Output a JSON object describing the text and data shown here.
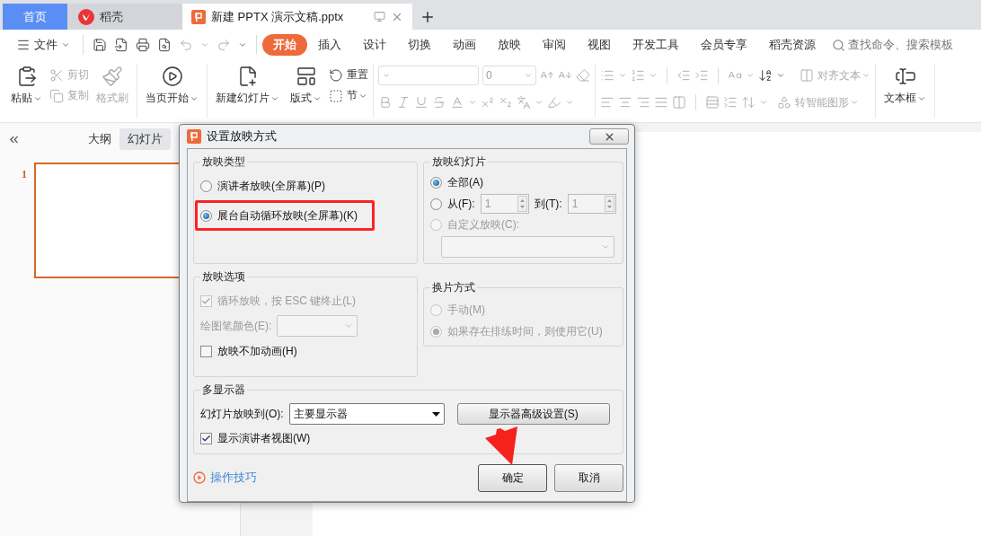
{
  "tabs": [
    {
      "label": "首页",
      "kind": "home",
      "selected": false
    },
    {
      "label": "稻壳",
      "kind": "app",
      "selected": false
    },
    {
      "label": "新建 PPTX 演示文稿.pptx",
      "kind": "document",
      "selected": true
    }
  ],
  "menu": {
    "file_label": "文件",
    "tabs": [
      {
        "label": "开始",
        "selected": true
      },
      {
        "label": "插入",
        "selected": false
      },
      {
        "label": "设计",
        "selected": false
      },
      {
        "label": "切换",
        "selected": false
      },
      {
        "label": "动画",
        "selected": false
      },
      {
        "label": "放映",
        "selected": false
      },
      {
        "label": "审阅",
        "selected": false
      },
      {
        "label": "视图",
        "selected": false
      },
      {
        "label": "开发工具",
        "selected": false
      },
      {
        "label": "会员专享",
        "selected": false
      },
      {
        "label": "稻壳资源",
        "selected": false
      }
    ],
    "search": {
      "placeholder": "查找命令、搜索模板"
    }
  },
  "ribbon": {
    "groups": [
      {
        "kind": "buttons",
        "items": [
          {
            "label": "粘贴",
            "kind": "large",
            "dropdown": true,
            "disabled": false
          },
          {
            "label": "剪切",
            "kind": "small",
            "dropdown": false,
            "disabled": true
          },
          {
            "label": "复制",
            "kind": "small",
            "dropdown": false,
            "disabled": true
          },
          {
            "label": "格式刷",
            "kind": "large",
            "dropdown": false,
            "disabled": true
          }
        ]
      },
      {
        "kind": "buttons",
        "items": [
          {
            "label": "当页开始",
            "kind": "large",
            "dropdown": true,
            "disabled": false
          }
        ]
      },
      {
        "kind": "buttons",
        "items": [
          {
            "label": "新建幻灯片",
            "kind": "large",
            "dropdown": true,
            "disabled": false
          },
          {
            "label": "版式",
            "kind": "large",
            "dropdown": true,
            "disabled": false
          },
          {
            "label": "重置",
            "kind": "small",
            "dropdown": false,
            "disabled": false
          },
          {
            "label": "节",
            "kind": "small",
            "dropdown": true,
            "disabled": false
          }
        ]
      },
      {
        "kind": "font",
        "size_value": "0",
        "disabled": true
      },
      {
        "kind": "paragraph",
        "disabled": true,
        "items": [
          {
            "label": "对齐文本",
            "kind": "small",
            "dropdown": true,
            "disabled": true
          },
          {
            "label": "转智能图形",
            "kind": "small",
            "dropdown": true,
            "disabled": true
          }
        ]
      },
      {
        "kind": "buttons",
        "items": [
          {
            "label": "文本框",
            "kind": "large",
            "dropdown": true,
            "disabled": false
          }
        ]
      }
    ]
  },
  "left_pane": {
    "tabs": [
      {
        "label": "大纲",
        "selected": false
      },
      {
        "label": "幻灯片",
        "selected": true
      }
    ],
    "slides": [
      {
        "number": "1",
        "selected": true
      }
    ]
  },
  "dialog": {
    "title": "设置放映方式",
    "show_type": {
      "title": "放映类型",
      "options": [
        {
          "label": "演讲者放映(全屏幕)(P)",
          "selected": false,
          "highlighted": false
        },
        {
          "label": "展台自动循环放映(全屏幕)(K)",
          "selected": true,
          "highlighted": true
        }
      ]
    },
    "show_slides": {
      "title": "放映幻灯片",
      "all": {
        "label": "全部(A)",
        "selected": true
      },
      "range": {
        "label": "从(F):",
        "selected": false,
        "from_value": "1",
        "to_label": "到(T):",
        "to_value": "1"
      },
      "custom": {
        "label": "自定义放映(C):",
        "selected": false,
        "disabled": true
      }
    },
    "show_options": {
      "title": "放映选项",
      "loop": {
        "label": "循环放映，按 ESC 键终止(L)",
        "checked": true,
        "disabled": true
      },
      "pen_color": {
        "label": "绘图笔颜色(E):",
        "disabled": true
      },
      "no_animation": {
        "label": "放映不加动画(H)",
        "checked": false,
        "disabled": false
      }
    },
    "advance": {
      "title": "换片方式",
      "options": [
        {
          "label": "手动(M)",
          "selected": false,
          "disabled": true
        },
        {
          "label": "如果存在排练时间，则使用它(U)",
          "selected": true,
          "disabled": true
        }
      ]
    },
    "monitors": {
      "title": "多显示器",
      "target_label": "幻灯片放映到(O):",
      "target_value": "主要显示器",
      "advanced_button": "显示器高级设置(S)",
      "presenter_view": {
        "label": "显示演讲者视图(W)",
        "checked": true,
        "disabled": false
      }
    },
    "tips_link": "操作技巧",
    "buttons": [
      {
        "label": "确定",
        "kind": "primary"
      },
      {
        "label": "取消",
        "kind": "normal"
      }
    ]
  },
  "pointer_arrow": true
}
